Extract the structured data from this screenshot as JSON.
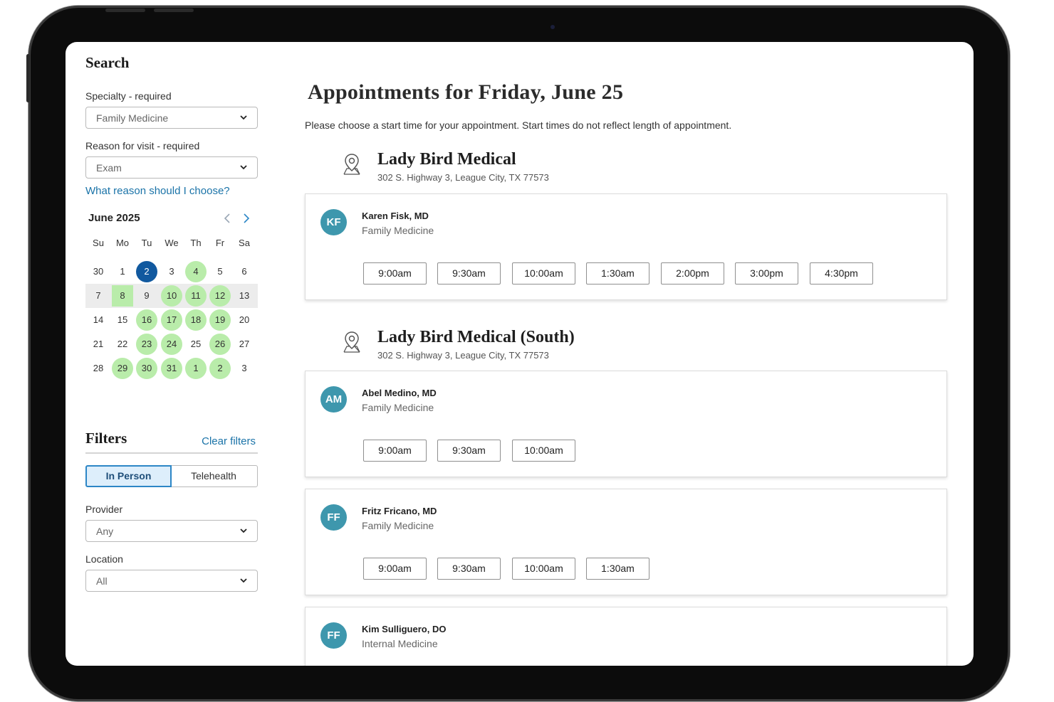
{
  "sidebar": {
    "search_title": "Search",
    "specialty_label": "Specialty - required",
    "specialty_value": "Family Medicine",
    "reason_label": "Reason for visit  - required",
    "reason_value": "Exam",
    "reason_help_link": "What reason should I choose?",
    "calendar": {
      "month_label": "June 2025",
      "weekdays": [
        "Su",
        "Mo",
        "Tu",
        "We",
        "Th",
        "Fr",
        "Sa"
      ],
      "weeks": [
        [
          "30",
          "1",
          "2",
          "3",
          "4",
          "5",
          "6"
        ],
        [
          "7",
          "8",
          "9",
          "10",
          "11",
          "12",
          "13"
        ],
        [
          "14",
          "15",
          "16",
          "17",
          "18",
          "19",
          "20"
        ],
        [
          "21",
          "22",
          "23",
          "24",
          "25",
          "26",
          "27"
        ],
        [
          "28",
          "29",
          "30",
          "31",
          "1",
          "2",
          "3"
        ]
      ],
      "available_color": "#b9ecaa",
      "today_color": "#11599f"
    },
    "filters_title": "Filters",
    "clear_filters": "Clear filters",
    "visit_type_options": [
      "In Person",
      "Telehealth"
    ],
    "visit_type_selected": "In Person",
    "provider_label": "Provider",
    "provider_value": "Any",
    "location_label": "Location",
    "location_value": "All"
  },
  "main": {
    "title": "Appointments for Friday, June 25",
    "subtitle": "Please choose a start time for your appointment. Start times do not reflect length of appointment.",
    "locations": [
      {
        "name": "Lady Bird Medical",
        "address": "302 S. Highway 3, League City, TX 77573",
        "providers": [
          {
            "initials": "KF",
            "name": "Karen Fisk, MD",
            "specialty": "Family Medicine",
            "slots": [
              "9:00am",
              "9:30am",
              "10:00am",
              "1:30am",
              "2:00pm",
              "3:00pm",
              "4:30pm"
            ]
          }
        ]
      },
      {
        "name": "Lady Bird Medical (South)",
        "address": "302 S. Highway 3, League City, TX 77573",
        "providers": [
          {
            "initials": "AM",
            "name": "Abel Medino, MD",
            "specialty": "Family Medicine",
            "slots": [
              "9:00am",
              "9:30am",
              "10:00am"
            ]
          },
          {
            "initials": "FF",
            "name": "Fritz Fricano, MD",
            "specialty": "Family Medicine",
            "slots": [
              "9:00am",
              "9:30am",
              "10:00am",
              "1:30am"
            ]
          },
          {
            "initials": "FF",
            "name": "Kim Sulliguero, DO",
            "specialty": "Internal Medicine",
            "slots": []
          }
        ]
      }
    ]
  },
  "colors": {
    "accent_link": "#1a73a8",
    "avatar_bg": "#3e97ad",
    "frame": "#0c0c0c"
  }
}
